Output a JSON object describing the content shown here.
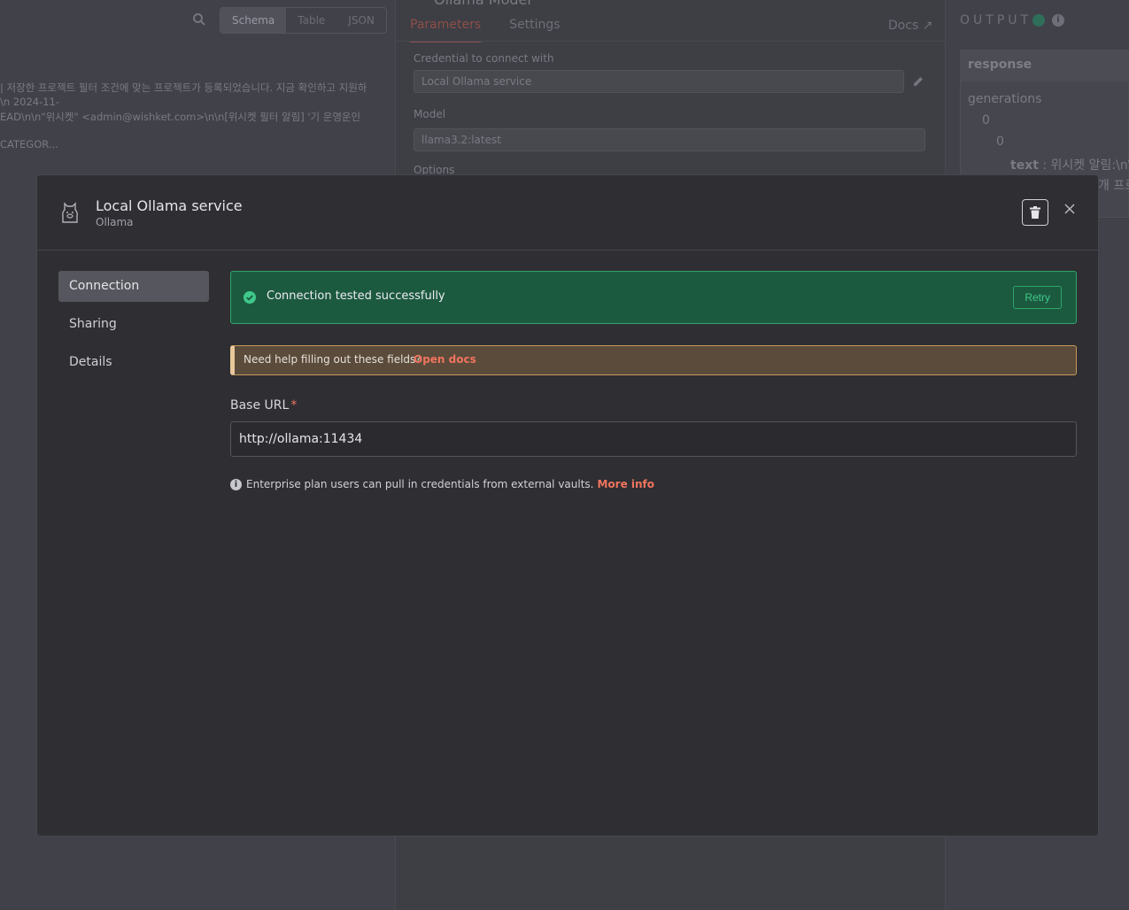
{
  "background": {
    "view_modes": [
      "Schema",
      "Table",
      "JSON"
    ],
    "active_view": "Schema",
    "left_lines": [
      "| 저장한 프로젝트 필터 조건에 맞는 프로젝트가 등록되었습니다. 지금 확인하고 지원하",
      "\\n 2024-11-",
      "EAD\\n\\n\"위시켓\" <admin@wishket.com>\\n\\n[위시켓 필터 알림] '기 운영운인",
      "CATEGOR..."
    ],
    "node_title": "Ollama Model",
    "tabs": [
      "Parameters",
      "Settings"
    ],
    "docs_label": "Docs",
    "credential_label": "Credential to connect with",
    "credential_value": "Local Ollama service",
    "model_label": "Model",
    "model_value": "llama3.2:latest",
    "options_label": "Options",
    "output_title": "OUTPUT",
    "response_label": "response",
    "tree": {
      "generations": "generations",
      "index0": "0",
      "index1": "0",
      "text_key": "text",
      "text_value": ": 위시켓 알림:\\n\\",
      "text_more": "개 프로"
    }
  },
  "modal": {
    "title": "Local Ollama service",
    "subtitle": "Ollama",
    "nav": [
      "Connection",
      "Sharing",
      "Details"
    ],
    "active_nav": "Connection",
    "success_message": "Connection tested successfully",
    "retry_label": "Retry",
    "help_text": "Need help filling out these fields?",
    "help_link": "Open docs",
    "base_url_label": "Base URL",
    "required_mark": "*",
    "base_url_value": "http://ollama:11434",
    "note_text": "Enterprise plan users can pull in credentials from external vaults.",
    "note_link": "More info"
  },
  "colors": {
    "accent": "#f0745e",
    "success": "#2fa46c",
    "warning": "#e8c79a"
  }
}
